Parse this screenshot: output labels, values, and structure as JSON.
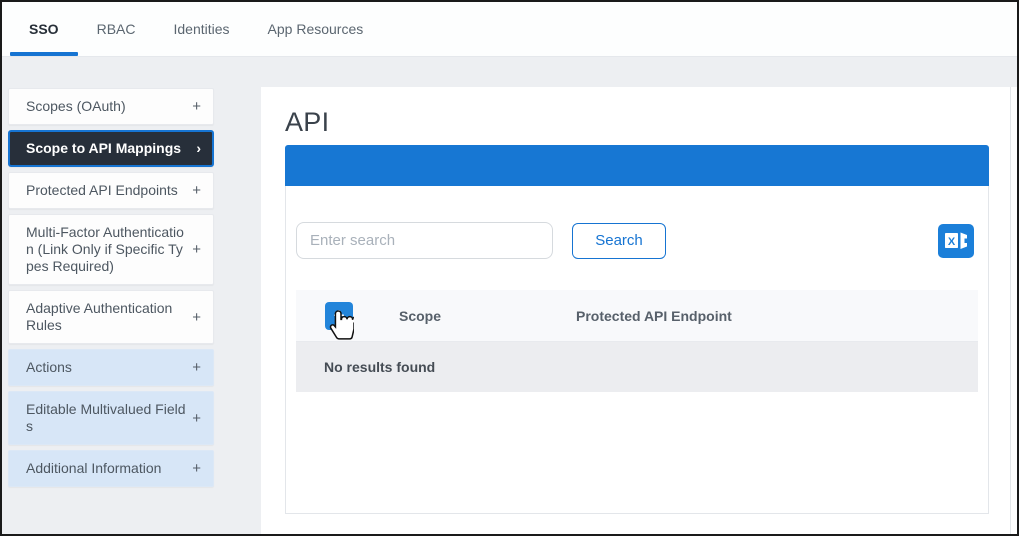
{
  "tabs": [
    {
      "label": "SSO",
      "active": true
    },
    {
      "label": "RBAC",
      "active": false
    },
    {
      "label": "Identities",
      "active": false
    },
    {
      "label": "App Resources",
      "active": false
    }
  ],
  "sidebar": {
    "items": [
      {
        "label": "Scopes (OAuth)",
        "expand_icon": "+",
        "state": "default"
      },
      {
        "label": "Scope to API Mappings",
        "expand_icon": "›",
        "state": "selected"
      },
      {
        "label": "Protected API Endpoints",
        "expand_icon": "+",
        "state": "default"
      },
      {
        "label": "Multi-Factor Authentication (Link Only if Specific Types Required)",
        "expand_icon": "+",
        "state": "default"
      },
      {
        "label": "Adaptive Authentication Rules",
        "expand_icon": "+",
        "state": "default"
      },
      {
        "label": "Actions",
        "expand_icon": "+",
        "state": "highlighted"
      },
      {
        "label": "Editable Multivalued Fields",
        "expand_icon": "+",
        "state": "highlighted"
      },
      {
        "label": "Additional Information",
        "expand_icon": "+",
        "state": "highlighted"
      }
    ]
  },
  "main": {
    "title": "API",
    "search": {
      "placeholder": "Enter search",
      "value": "",
      "button_label": "Search"
    },
    "export": {
      "icon": "excel-export-icon"
    },
    "table": {
      "add_button_label": "+",
      "columns": [
        "Scope",
        "Protected API Endpoint"
      ],
      "empty_message": "No results found",
      "rows": []
    }
  },
  "cursor": {
    "icon": "hand-pointer-cursor"
  },
  "colors": {
    "accent_blue": "#1777d3",
    "selected_item_bg": "#272f3a",
    "selected_item_border": "#1674d2",
    "highlight_item_bg": "#d7e6f7",
    "page_bg": "#edeff2",
    "table_header_bg": "#f8f9fb",
    "empty_row_bg": "#ecedf0"
  }
}
